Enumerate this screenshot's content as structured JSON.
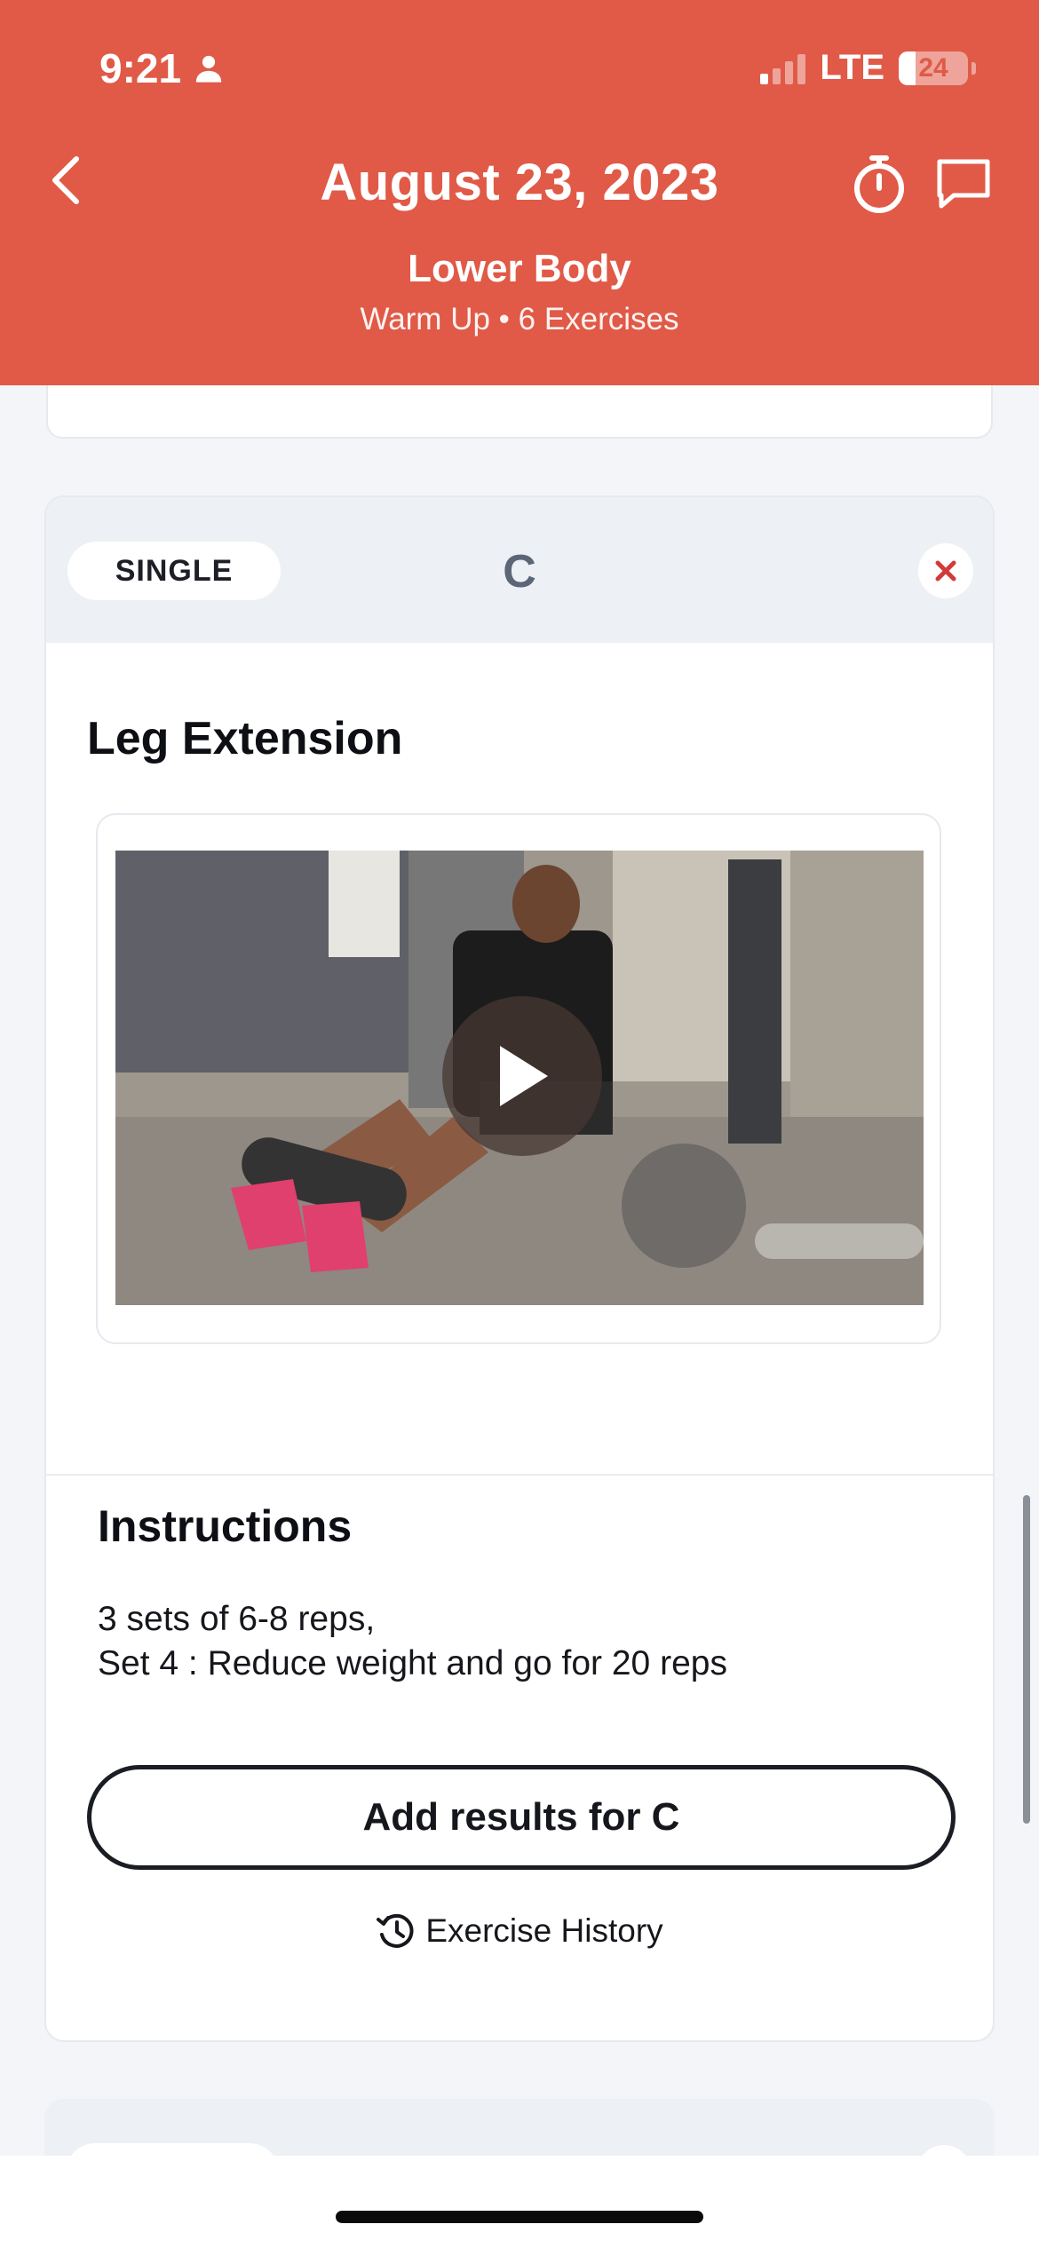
{
  "colors": {
    "accent": "#e05a47",
    "close_icon": "#d23b3b"
  },
  "status_bar": {
    "time": "9:21",
    "network": "LTE",
    "battery_level": "24",
    "battery_fraction": 0.24,
    "signal_bars_active": 1
  },
  "header": {
    "title": "August 23, 2023",
    "subtitle": "Lower Body",
    "meta": "Warm Up • 6 Exercises",
    "icons": [
      "chevron-left-icon",
      "stopwatch-icon",
      "chat-bubble-icon"
    ]
  },
  "exercise": {
    "type_label": "SINGLE",
    "group_letter": "C",
    "name": "Leg Extension",
    "instructions_title": "Instructions",
    "instructions": [
      "3 sets of 6-8 reps,",
      "Set 4 : Reduce weight and go for 20 reps"
    ],
    "add_results_label": "Add results for C",
    "history_label": "Exercise History"
  }
}
